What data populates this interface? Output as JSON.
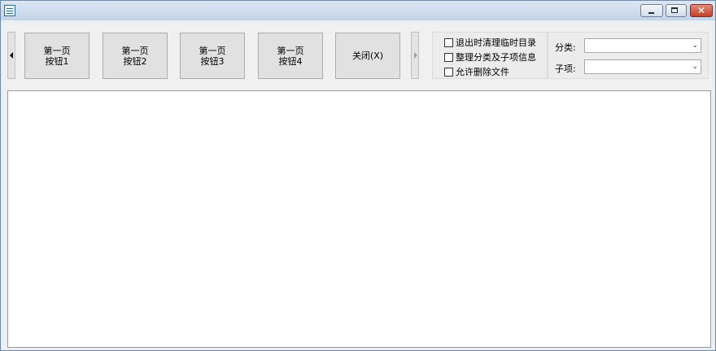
{
  "window": {
    "icon": "app-icon",
    "buttons": {
      "minimize": "minimize-icon",
      "maximize": "maximize-icon",
      "close_glyph": "✕"
    }
  },
  "toolbar": {
    "buttons": [
      {
        "line1": "第一页",
        "line2": "按钮1"
      },
      {
        "line1": "第一页",
        "line2": "按钮2"
      },
      {
        "line1": "第一页",
        "line2": "按钮3"
      },
      {
        "line1": "第一页",
        "line2": "按钮4"
      },
      {
        "line1": "关闭(X)",
        "line2": ""
      }
    ],
    "left_scroll_icon": "left-triangle-icon",
    "right_scroll_icon": "right-triangle-icon"
  },
  "options": {
    "checkboxes": [
      {
        "label": "退出时清理临时目录",
        "checked": false
      },
      {
        "label": "整理分类及子项信息",
        "checked": false
      },
      {
        "label": "允许删除文件",
        "checked": false
      }
    ]
  },
  "filters": {
    "category_label": "分类:",
    "category_value": "",
    "subitem_label": "子项:",
    "subitem_value": ""
  },
  "colors": {
    "frame": "#6f8aa8",
    "close_button": "#c2412c",
    "client_bg": "#f0f0f0"
  }
}
